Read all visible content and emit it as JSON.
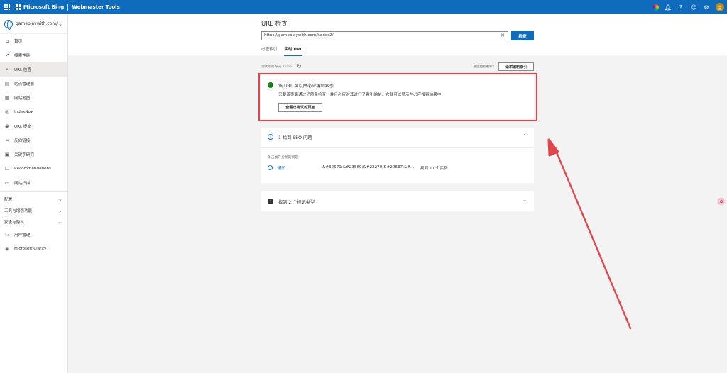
{
  "topbar": {
    "brand": "Microsoft Bing",
    "product": "Webmaster Tools",
    "avatar_initial": "圭"
  },
  "sidebar": {
    "site": "gameplaywith.com/",
    "items": [
      {
        "label": "首页",
        "icon": "home-icon",
        "glyph": "⌂"
      },
      {
        "label": "搜索性能",
        "icon": "trend-icon",
        "glyph": "↗"
      },
      {
        "label": "URL 检查",
        "icon": "search-icon",
        "glyph": "⌕",
        "active": true
      },
      {
        "label": "站点管理器",
        "icon": "document-icon",
        "glyph": "▤"
      },
      {
        "label": "网站地图",
        "icon": "sitemap-icon",
        "glyph": "▦"
      },
      {
        "label": "IndexNow",
        "icon": "indexnow-icon",
        "glyph": "◎"
      },
      {
        "label": "URL 提交",
        "icon": "globe-icon",
        "glyph": "◉"
      },
      {
        "label": "反向链接",
        "icon": "link-icon",
        "glyph": "∞"
      },
      {
        "label": "关键字研究",
        "icon": "keyword-icon",
        "glyph": "▣"
      },
      {
        "label": "Recommendations",
        "icon": "recommendations-icon",
        "glyph": "☐"
      },
      {
        "label": "网站扫描",
        "icon": "scan-icon",
        "glyph": "▭"
      }
    ],
    "groups": [
      {
        "label": "配置"
      },
      {
        "label": "工具与增强功能"
      },
      {
        "label": "安全与隐私"
      }
    ],
    "bottom_items": [
      {
        "label": "用户管理",
        "icon": "users-icon",
        "glyph": "⚇"
      },
      {
        "label": "Microsoft Clarity",
        "icon": "clarity-icon",
        "glyph": "◈"
      }
    ]
  },
  "main": {
    "title": "URL 检查",
    "url_value": "https://gameplaywith.com/hades2/",
    "inspect_label": "检查",
    "tabs": [
      {
        "label": "必应索引",
        "active": false
      },
      {
        "label": "实时 URL",
        "active": true
      }
    ],
    "test_time": "测试时间 今天 15:55",
    "last_refresh": "最后更新刷新？",
    "request_index_label": "请求编制索引"
  },
  "result": {
    "title": "该 URL 可以由必应编制索引",
    "description": "只要该页面通过了质量检查，并且必应对其进行了索引编制，它就可以显示在必应搜索结果中",
    "view_button": "查看已测试的页面"
  },
  "seo": {
    "title": "1 找到 SEO 问题",
    "sub": "单击展开分析的问题",
    "rows": [
      {
        "level": "通知",
        "name": "&#32570;&#23569;&#22270;&#20687;&#...",
        "count": "找到 11 个实例"
      }
    ]
  },
  "markup": {
    "title": "找到 2 个标记类型"
  },
  "colors": {
    "accent": "#0f6cbd",
    "success": "#107c10",
    "highlight": "#e0464b"
  }
}
